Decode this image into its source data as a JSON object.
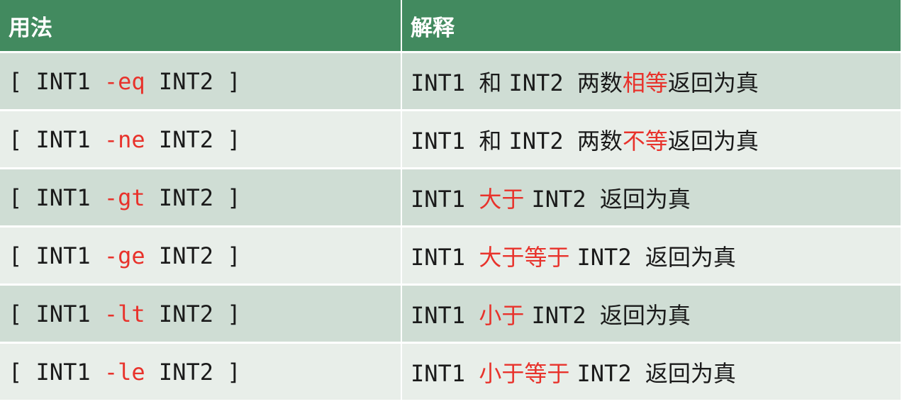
{
  "colors": {
    "header_bg": "#428a5f",
    "row_odd_bg": "#cfddd4",
    "row_even_bg": "#e8eee9",
    "highlight": "#e8322b"
  },
  "header": {
    "usage": "用法",
    "explanation": "解释"
  },
  "rows": [
    {
      "usage_pre": "[ INT1 ",
      "usage_op": "-eq",
      "usage_post": " INT2 ]",
      "desc_a": "INT1 ",
      "desc_b": "和 ",
      "desc_c": "INT2 ",
      "desc_d": "两数",
      "desc_hl": "相等",
      "desc_e": "返回为真"
    },
    {
      "usage_pre": "[ INT1 ",
      "usage_op": "-ne",
      "usage_post": " INT2 ]",
      "desc_a": "INT1 ",
      "desc_b": "和 ",
      "desc_c": "INT2 ",
      "desc_d": "两数",
      "desc_hl": "不等",
      "desc_e": "返回为真"
    },
    {
      "usage_pre": "[ INT1 ",
      "usage_op": "-gt",
      "usage_post": " INT2 ]",
      "desc_a": "INT1 ",
      "desc_hl": "大于 ",
      "desc_c": "INT2 ",
      "desc_e": "返回为真"
    },
    {
      "usage_pre": "[ INT1 ",
      "usage_op": "-ge",
      "usage_post": " INT2 ]",
      "desc_a": "INT1 ",
      "desc_hl": "大于等于 ",
      "desc_c": "INT2 ",
      "desc_e": "返回为真"
    },
    {
      "usage_pre": "[ INT1 ",
      "usage_op": "-lt",
      "usage_post": " INT2 ]",
      "desc_a": "INT1 ",
      "desc_hl": "小于 ",
      "desc_c": "INT2 ",
      "desc_e": "返回为真"
    },
    {
      "usage_pre": "[ INT1 ",
      "usage_op": "-le",
      "usage_post": " INT2 ]",
      "desc_a": "INT1 ",
      "desc_hl": "小于等于 ",
      "desc_c": "INT2 ",
      "desc_e": "返回为真"
    }
  ]
}
